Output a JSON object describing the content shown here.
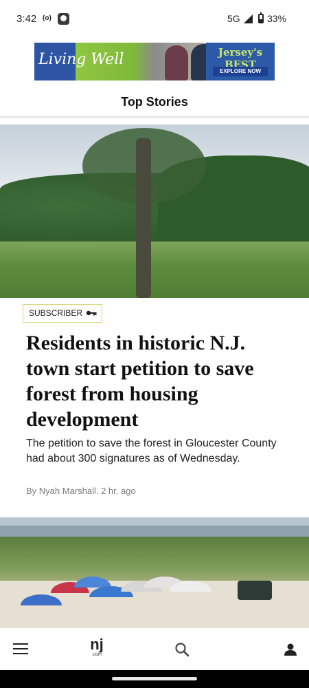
{
  "status_bar": {
    "time": "3:42",
    "cast_indicator": "(o)",
    "network": "5G",
    "battery": "33%",
    "icons": [
      "cast-icon",
      "app-notification-icon",
      "signal-icon",
      "battery-icon"
    ]
  },
  "ad": {
    "brand_left": "Living Well",
    "logo_right": "Jersey's BEST",
    "cta": "EXPLORE NOW",
    "colors": {
      "blue": "#2d55a3",
      "green": "#8ec63f"
    }
  },
  "section": {
    "title": "Top Stories"
  },
  "articles": [
    {
      "badge": "SUBSCRIBER",
      "badge_icon": "key-icon",
      "headline": "Residents in historic N.J. town start petition to save forest from housing development",
      "summary": "The petition to save the forest in Gloucester County had about 300 signatures as of Wednesday.",
      "byline": "By Nyah Marshall. 2 hr. ago"
    }
  ],
  "bottom_nav": {
    "logo_text": "nj",
    "logo_subtext": ".com",
    "items": [
      "menu-icon",
      "nj-logo",
      "search-icon",
      "profile-icon"
    ]
  }
}
